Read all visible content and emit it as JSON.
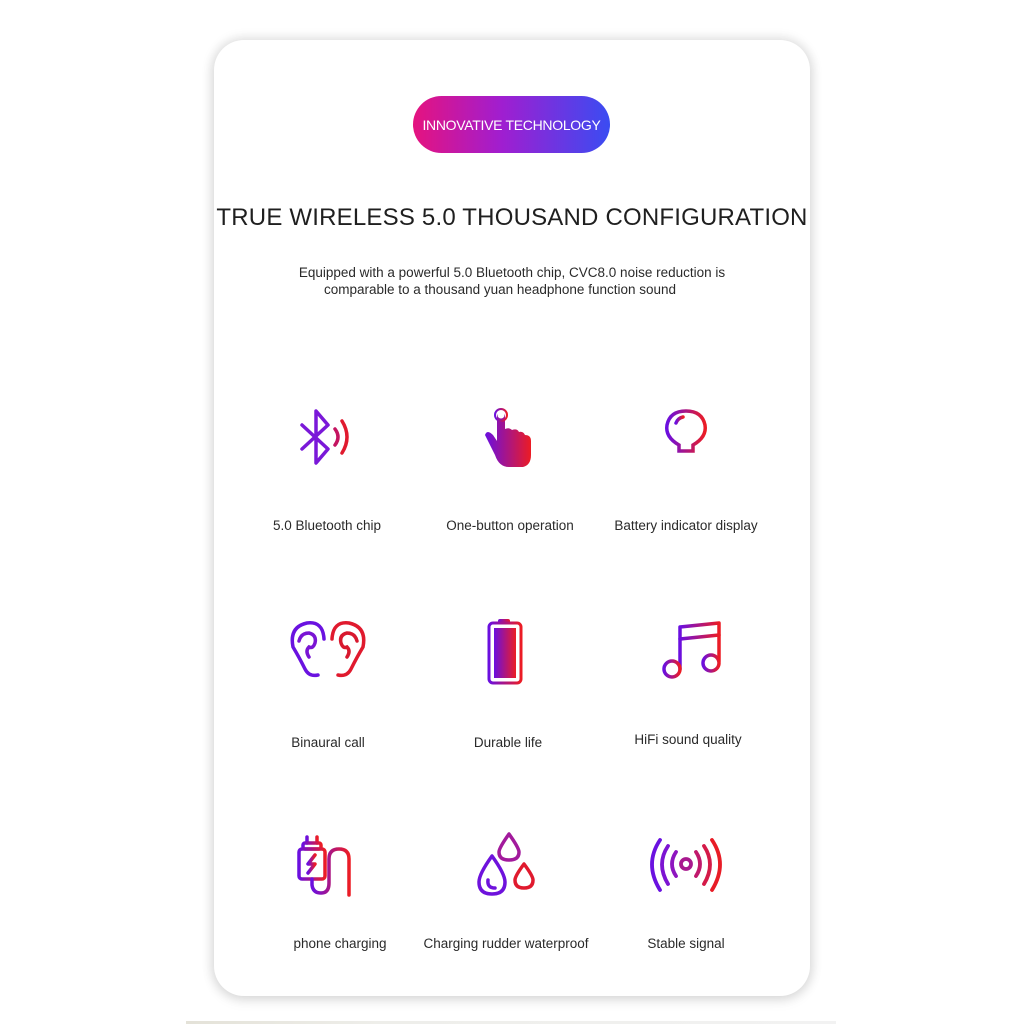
{
  "badge": {
    "label": "INNOVATIVE TECHNOLOGY"
  },
  "header": {
    "title": "TRUE WIRELESS 5.0 THOUSAND CONFIGURATION",
    "subtitle_line1": "Equipped with a powerful 5.0 Bluetooth chip, CVC8.0 noise reduction is",
    "subtitle_line2": "comparable to a thousand yuan headphone function sound"
  },
  "colors": {
    "gradient_start": "#6a0fe0",
    "gradient_end": "#ec1c24",
    "badge_start": "#e5137f",
    "badge_end": "#3a4cf2"
  },
  "features": [
    {
      "icon": "bluetooth-icon",
      "label": "5.0 Bluetooth chip"
    },
    {
      "icon": "finger-tap-icon",
      "label": "One-button operation"
    },
    {
      "icon": "light-bulb-icon",
      "label": "Battery indicator display"
    },
    {
      "icon": "ears-icon",
      "label": "Binaural call"
    },
    {
      "icon": "battery-icon",
      "label": "Durable life"
    },
    {
      "icon": "music-note-icon",
      "label": "HiFi sound quality"
    },
    {
      "icon": "charger-icon",
      "label": "phone charging"
    },
    {
      "icon": "water-drops-icon",
      "label": "Charging rudder waterproof"
    },
    {
      "icon": "signal-icon",
      "label": "Stable signal"
    }
  ]
}
